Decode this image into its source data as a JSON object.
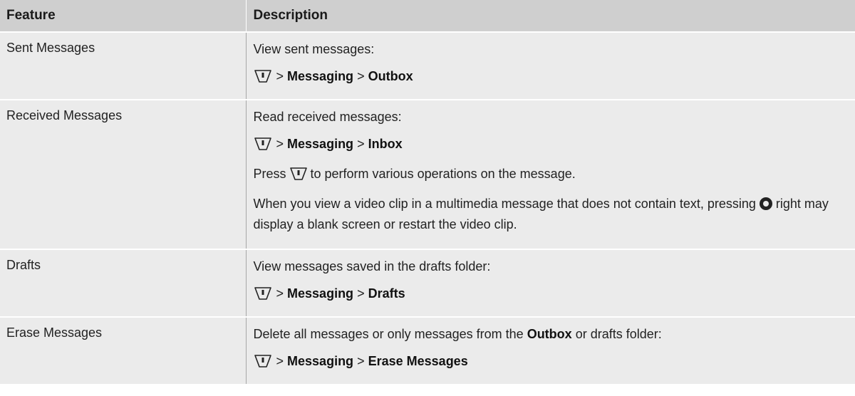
{
  "header": {
    "feature": "Feature",
    "description": "Description"
  },
  "icons": {
    "menu_key": "menu-key-icon",
    "nav_key": "navigation-key-icon"
  },
  "colors": {
    "header_bg": "#cfcfcf",
    "row_bg": "#ebebeb"
  },
  "rows": [
    {
      "feature": "Sent Messages",
      "intro": "View sent messages:",
      "path": {
        "sep1": ">",
        "p1": "Messaging",
        "sep2": ">",
        "p2": "Outbox"
      }
    },
    {
      "feature": "Received Messages",
      "intro": "Read received messages:",
      "path": {
        "sep1": ">",
        "p1": "Messaging",
        "sep2": ">",
        "p2": "Inbox"
      },
      "press_pre": "Press",
      "press_post": "to perform various operations on the message.",
      "note_pre": "When you view a video clip in a multimedia message that does not contain text, pressing",
      "note_post": "right may display a blank screen or restart the video clip."
    },
    {
      "feature": "Drafts",
      "intro": "View messages saved in the drafts folder:",
      "path": {
        "sep1": ">",
        "p1": "Messaging",
        "sep2": ">",
        "p2": "Drafts"
      }
    },
    {
      "feature": "Erase Messages",
      "intro_pre": "Delete all messages or only messages from the",
      "intro_bold": "Outbox",
      "intro_post": "or drafts folder:",
      "path": {
        "sep1": ">",
        "p1": "Messaging",
        "sep2": ">",
        "p2": "Erase Messages"
      }
    }
  ]
}
